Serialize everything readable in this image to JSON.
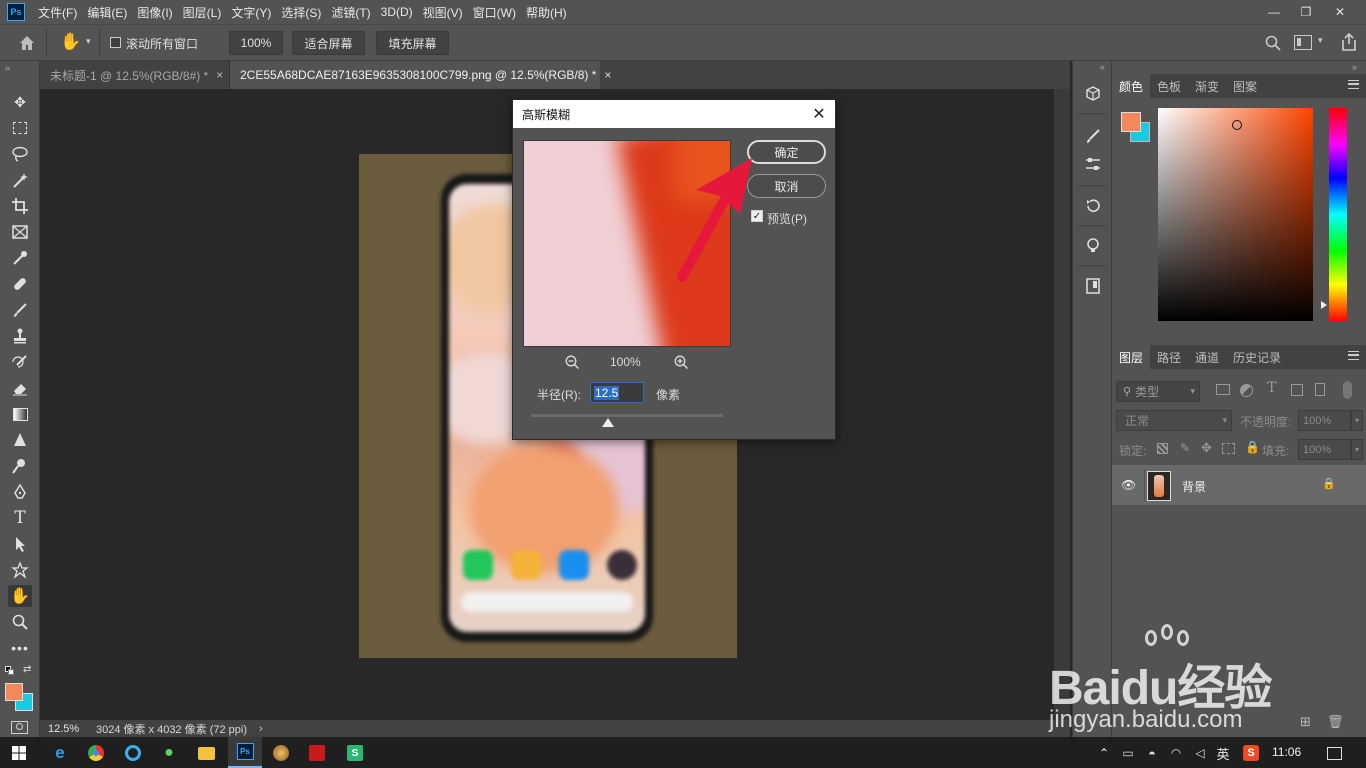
{
  "menubar": {
    "logo": "Ps",
    "items": [
      "文件(F)",
      "编辑(E)",
      "图像(I)",
      "图层(L)",
      "文字(Y)",
      "选择(S)",
      "滤镜(T)",
      "3D(D)",
      "视图(V)",
      "窗口(W)",
      "帮助(H)"
    ]
  },
  "options": {
    "scroll_all_label": "滚动所有窗口",
    "zoom_value": "100%",
    "fit_screen": "适合屏幕",
    "fill_screen": "填充屏幕"
  },
  "tabs": [
    {
      "label": "未标题-1 @ 12.5%(RGB/8#) *",
      "close": "×"
    },
    {
      "label": "2CE55A68DCAE87163E9635308100C799.png @ 12.5%(RGB/8) *",
      "close": "×"
    }
  ],
  "statusbar": {
    "zoom": "12.5%",
    "doc_info": "3024 像素 x 4032 像素 (72 ppi)",
    "arrow": "›"
  },
  "dialog": {
    "title": "高斯模糊",
    "ok_label": "确定",
    "cancel_label": "取消",
    "preview_label": "预览(P)",
    "preview_zoom": "100%",
    "radius_label": "半径(R):",
    "radius_value": "12.5",
    "radius_unit": "像素",
    "slider_position": 0.4
  },
  "color_panel": {
    "tabs": [
      "颜色",
      "色板",
      "渐变",
      "图案"
    ],
    "foreground": "#f4885a",
    "background": "#1ec8e0",
    "hue_base": "#ff4400"
  },
  "layers_panel": {
    "tabs": [
      "图层",
      "路径",
      "通道",
      "历史记录"
    ],
    "filter_placeholder": "类型",
    "blend_mode": "正常",
    "opacity_label": "不透明度:",
    "opacity_value": "100%",
    "lock_label": "锁定:",
    "fill_label": "填充:",
    "fill_value": "100%",
    "layers": [
      {
        "name": "背景",
        "visible": true,
        "locked": true
      }
    ]
  },
  "taskbar": {
    "ime": "英",
    "time": "11:06"
  },
  "watermark": {
    "brand": "Baidu经验",
    "url": "jingyan.baidu.com"
  }
}
